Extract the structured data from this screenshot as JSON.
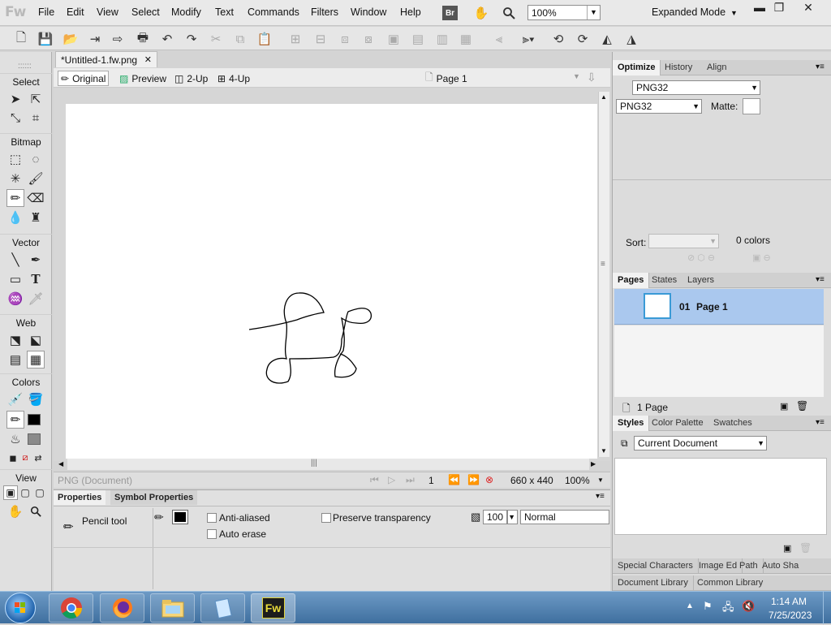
{
  "app": {
    "logo": "Fw"
  },
  "menu": [
    "File",
    "Edit",
    "View",
    "Select",
    "Modify",
    "Text",
    "Commands",
    "Filters",
    "Window",
    "Help"
  ],
  "bridge_label": "Br",
  "zoom_value": "100%",
  "mode_label": "Expanded Mode",
  "document": {
    "tab_title": "*Untitled-1.fw.png"
  },
  "view_buttons": [
    "Original",
    "Preview",
    "2-Up",
    "4-Up"
  ],
  "page_selector": "Page 1",
  "tools": {
    "sections": [
      "Select",
      "Bitmap",
      "Vector",
      "Web",
      "Colors",
      "View"
    ]
  },
  "status": {
    "doc_type": "PNG (Document)",
    "frame": "1",
    "size": "660 x 440",
    "zoom": "100%"
  },
  "properties": {
    "tabs": [
      "Properties",
      "Symbol Properties"
    ],
    "tool_name": "Pencil tool",
    "anti_aliased": "Anti-aliased",
    "auto_erase": "Auto erase",
    "preserve_transparency": "Preserve transparency",
    "opacity": "100",
    "blend_mode": "Normal"
  },
  "optimize": {
    "tabs": [
      "Optimize",
      "History",
      "Align"
    ],
    "preset": "PNG32",
    "format": "PNG32",
    "matte_label": "Matte:",
    "sort_label": "Sort:",
    "colors_count": "0 colors"
  },
  "pages": {
    "tabs": [
      "Pages",
      "States",
      "Layers"
    ],
    "item_number": "01",
    "item_name": "Page 1",
    "footer": "1 Page"
  },
  "styles": {
    "tabs": [
      "Styles",
      "Color Palette",
      "Swatches"
    ],
    "library_select": "Current Document"
  },
  "bottom_tabs": {
    "row1": [
      "Special Characters",
      "Image Ed",
      "Path",
      "Auto Sha"
    ],
    "row2": [
      "Document Library",
      "Common Library"
    ]
  },
  "taskbar": {
    "time": "1:14 AM",
    "date": "7/25/2023",
    "fw_label": "Fw"
  },
  "colors": {
    "accent": "#9fc3ec",
    "taskbar": "#4a7aa9",
    "stroke": "#000000",
    "fill": "#8a8a8a"
  }
}
